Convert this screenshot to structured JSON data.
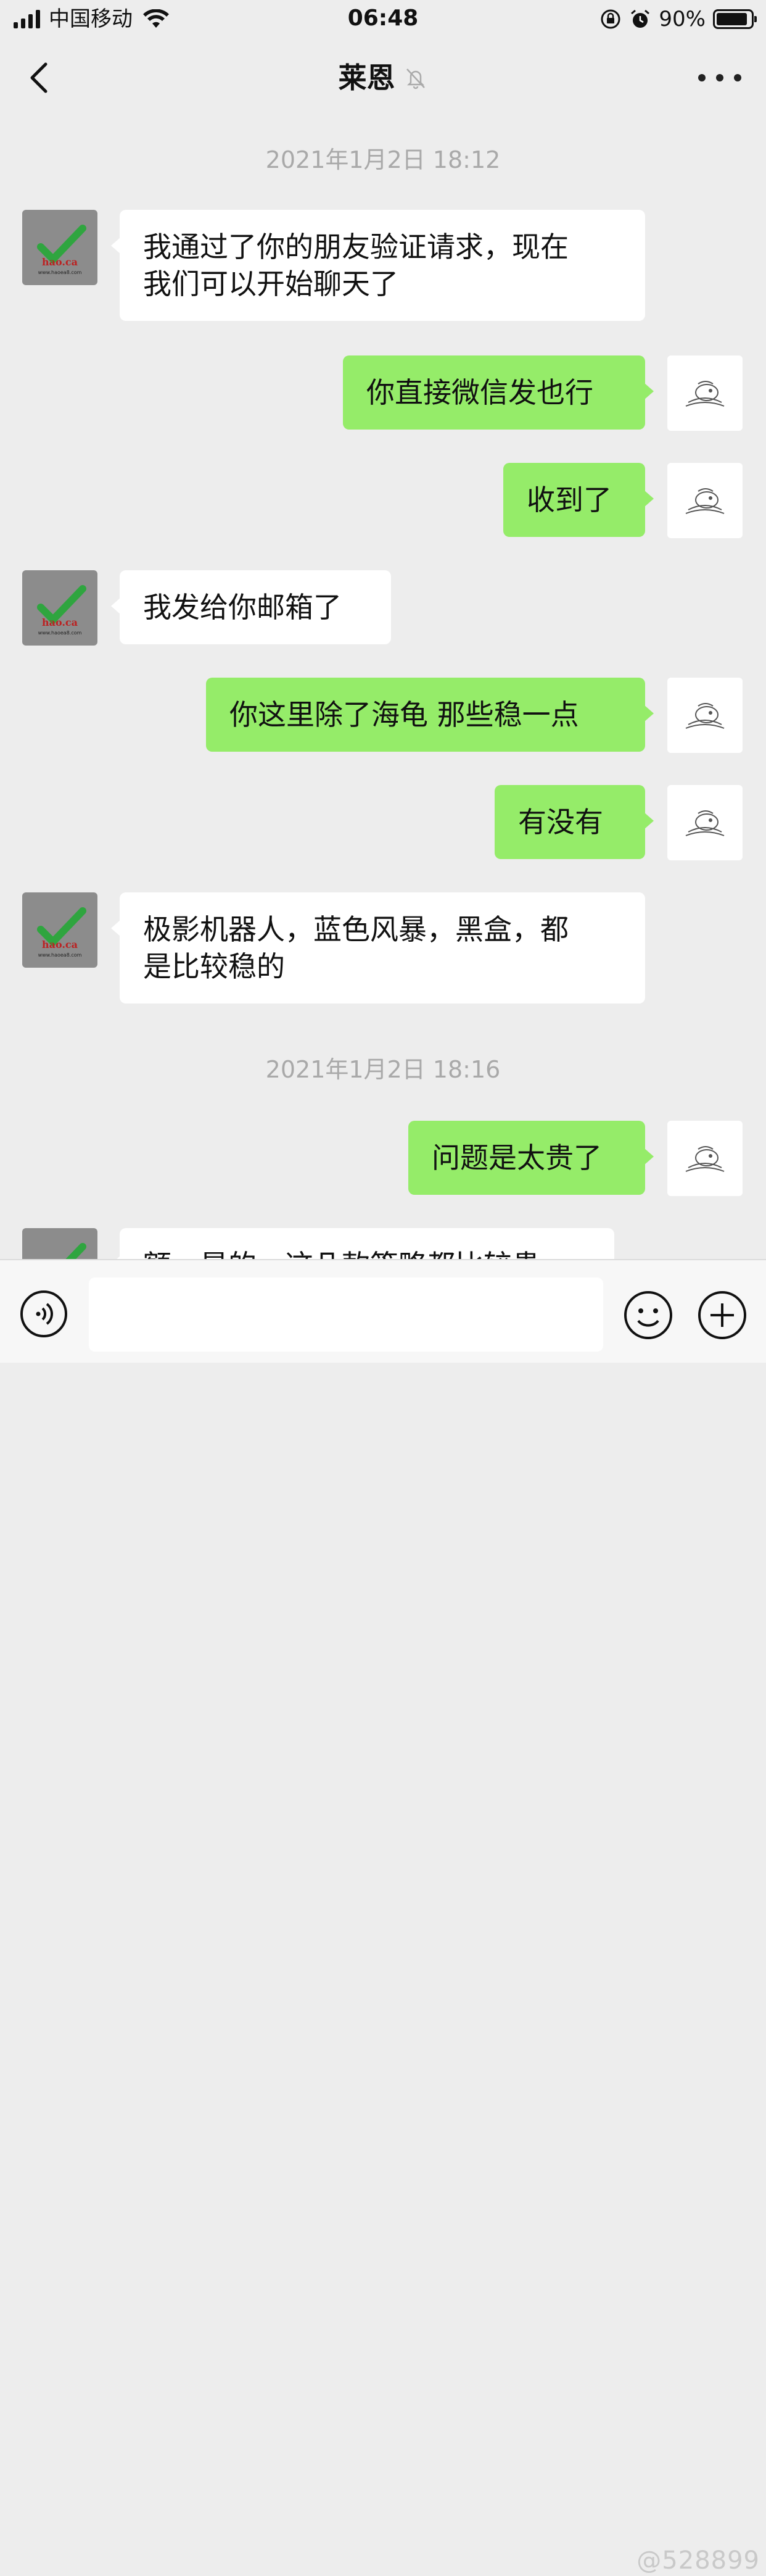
{
  "status_bar": {
    "carrier": "中国移动",
    "time": "06:48",
    "battery_percent": "90%",
    "battery_level": 0.9,
    "icons": [
      "signal-icon",
      "wifi-icon",
      "rotation-lock-icon",
      "alarm-icon",
      "battery-icon"
    ]
  },
  "nav": {
    "title": "莱恩",
    "back_icon": "chevron-left-icon",
    "mute_icon": "bell-off-icon",
    "more_icon": "more-horizontal-icon"
  },
  "chat": {
    "timestamps": [
      "2021年1月2日 18:12",
      "2021年1月2日 18:16"
    ],
    "avatar_left_text": [
      "hao.ca",
      "www.haoea8.com"
    ],
    "messages": [
      {
        "side": "left",
        "lines": [
          "我通过了你的朋友验证请求，现在",
          "我们可以开始聊天了"
        ]
      },
      {
        "side": "right",
        "lines": [
          "你直接微信发也行"
        ]
      },
      {
        "side": "right",
        "lines": [
          "收到了"
        ]
      },
      {
        "side": "left",
        "lines": [
          "我发给你邮箱了"
        ]
      },
      {
        "side": "right",
        "lines": [
          "你这里除了海龟 那些稳一点"
        ]
      },
      {
        "side": "right",
        "lines": [
          "有没有"
        ]
      },
      {
        "side": "left",
        "lines": [
          "极影机器人，蓝色风暴，黑盒，都",
          "是比较稳的"
        ]
      },
      {
        "side": "right",
        "lines": [
          "问题是太贵了"
        ]
      },
      {
        "side": "left",
        "lines": [
          "额，是的，这几款策略都比较贵"
        ]
      }
    ]
  },
  "input_bar": {
    "voice_icon": "voice-icon",
    "input_value": "",
    "emoji_icon": "emoji-icon",
    "plus_icon": "plus-circle-icon"
  },
  "watermark": "@528899"
}
